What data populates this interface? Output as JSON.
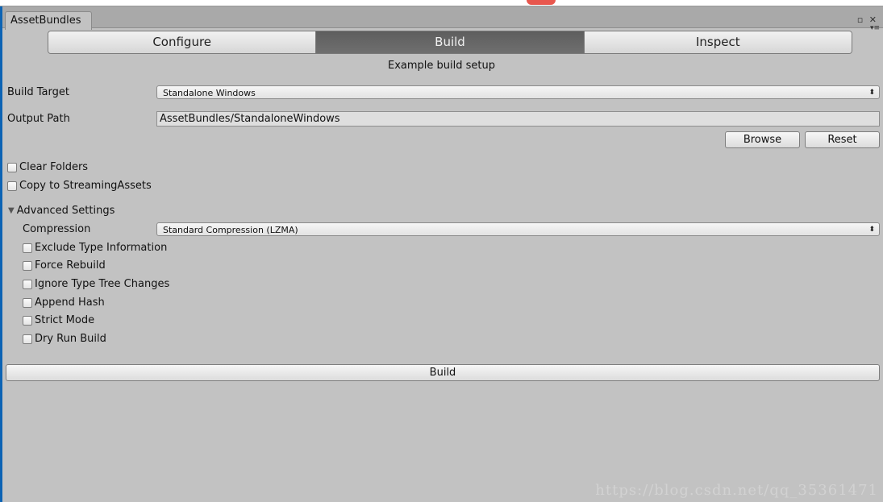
{
  "window": {
    "tab_title": "AssetBundles",
    "restore_glyph": "▫",
    "close_glyph": "✕",
    "menu_glyph": "▾≡"
  },
  "toolbar": {
    "tabs": [
      {
        "label": "Configure",
        "active": false
      },
      {
        "label": "Build",
        "active": true
      },
      {
        "label": "Inspect",
        "active": false
      }
    ]
  },
  "subtitle": "Example build setup",
  "build_target": {
    "label": "Build Target",
    "value": "Standalone Windows",
    "arrow": "⬍"
  },
  "output_path": {
    "label": "Output Path",
    "value": "AssetBundles/StandaloneWindows"
  },
  "buttons": {
    "browse": "Browse",
    "reset": "Reset",
    "build": "Build"
  },
  "options": {
    "clear_folders": {
      "label": "Clear Folders",
      "checked": false
    },
    "copy_streaming": {
      "label": "Copy to StreamingAssets",
      "checked": false
    }
  },
  "advanced": {
    "label": "Advanced Settings",
    "expanded_glyph": "▼",
    "compression": {
      "label": "Compression",
      "value": "Standard Compression (LZMA)",
      "arrow": "⬍"
    },
    "checkboxes": [
      {
        "label": "Exclude Type Information",
        "checked": false
      },
      {
        "label": "Force Rebuild",
        "checked": false
      },
      {
        "label": "Ignore Type Tree Changes",
        "checked": false
      },
      {
        "label": "Append Hash",
        "checked": false
      },
      {
        "label": "Strict Mode",
        "checked": false
      },
      {
        "label": "Dry Run Build",
        "checked": false
      }
    ]
  },
  "watermark": "https://blog.csdn.net/qq_35361471"
}
